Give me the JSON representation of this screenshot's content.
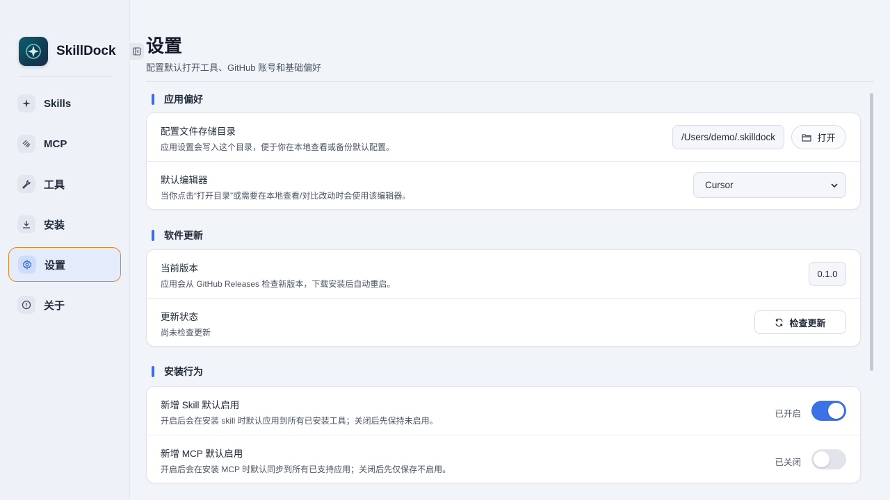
{
  "app": {
    "name": "SkillDock"
  },
  "sidebar": {
    "items": [
      {
        "label": "Skills",
        "icon": "sparkle-icon"
      },
      {
        "label": "MCP",
        "icon": "mcp-icon"
      },
      {
        "label": "工具",
        "icon": "wrench-icon"
      },
      {
        "label": "安装",
        "icon": "download-icon"
      },
      {
        "label": "设置",
        "icon": "gear-icon",
        "active": true
      },
      {
        "label": "关于",
        "icon": "info-icon"
      }
    ]
  },
  "header": {
    "title": "设置",
    "subtitle": "配置默认打开工具、GitHub 账号和基础偏好"
  },
  "sections": {
    "prefs": {
      "title": "应用偏好",
      "config_dir": {
        "title": "配置文件存储目录",
        "desc": "应用设置会写入这个目录，便于你在本地查看或备份默认配置。",
        "path": "/Users/demo/.skilldock",
        "open_label": "打开"
      },
      "editor": {
        "title": "默认编辑器",
        "desc": "当你点击“打开目录”或需要在本地查看/对比改动时会使用该编辑器。",
        "value": "Cursor"
      }
    },
    "update": {
      "title": "软件更新",
      "version": {
        "title": "当前版本",
        "desc": "应用会从 GitHub Releases 检查新版本，下载安装后自动重启。",
        "value": "0.1.0"
      },
      "status": {
        "title": "更新状态",
        "desc": "尚未检查更新",
        "check_label": "检查更新"
      }
    },
    "install": {
      "title": "安装行为",
      "skill_default": {
        "title": "新增 Skill 默认启用",
        "desc": "开启后会在安装 skill 时默认应用到所有已安装工具；关闭后先保持未启用。",
        "state_label": "已开启",
        "enabled": true
      },
      "mcp_default": {
        "title": "新增 MCP 默认启用",
        "desc": "开启后会在安装 MCP 时默认同步到所有已支持应用；关闭后先仅保存不启用。",
        "state_label": "已关闭",
        "enabled": false
      }
    }
  },
  "colors": {
    "accent": "#3b72e6",
    "active_border": "#d98a1f"
  }
}
